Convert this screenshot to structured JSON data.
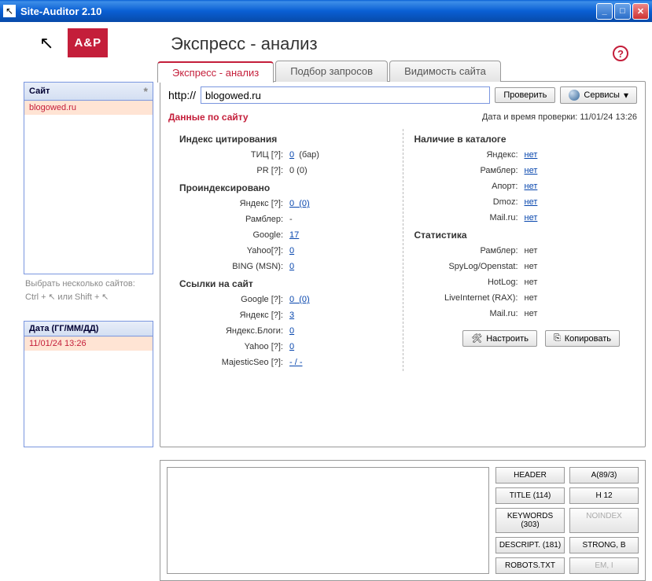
{
  "window": {
    "title": "Site-Auditor 2.10"
  },
  "header": {
    "logo": "A&P",
    "h1": "Экспресс - анализ"
  },
  "tabs": [
    "Экспресс - анализ",
    "Подбор запросов",
    "Видимость сайта"
  ],
  "activeTab": 0,
  "sidebar": {
    "sitesHeader": "Сайт",
    "sites": [
      "blogowed.ru"
    ],
    "hint1": "Выбрать несколько сайтов:",
    "hint2a": "Ctrl +",
    "hint2b": "или",
    "hint2c": "Shift +",
    "datesHeader": "Дата (ГГ/ММ/ДД)",
    "dates": [
      "11/01/24 13:26"
    ]
  },
  "url": {
    "proto": "http://",
    "value": "blogowed.ru",
    "check": "Проверить",
    "services": "Сервисы"
  },
  "dataHeader": "Данные по сайту",
  "checkedLabel": "Дата и время проверки:",
  "checkedValue": "11/01/24 13:26",
  "left": {
    "g1": "Индекс цитирования",
    "r1": {
      "l": "ТИЦ [?]:",
      "v": "0",
      "extra": "(бар)"
    },
    "r2": {
      "l": "PR [?]:",
      "v": "0 (0)"
    },
    "g2": "Проиндексировано",
    "r3": {
      "l": "Яндекс [?]:",
      "v": "0  (0)"
    },
    "r4": {
      "l": "Рамблер:",
      "v": "-"
    },
    "r5": {
      "l": "Google:",
      "v": "17"
    },
    "r6": {
      "l": "Yahoo[?]:",
      "v": "0"
    },
    "r7": {
      "l": "BING (MSN):",
      "v": "0"
    },
    "g3": "Ссылки на сайт",
    "r8": {
      "l": "Google [?]:",
      "v": "0  (0)"
    },
    "r9": {
      "l": "Яндекс [?]:",
      "v": "3"
    },
    "r10": {
      "l": "Яндекс.Блоги:",
      "v": "0"
    },
    "r11": {
      "l": "Yahoo [?]:",
      "v": "0"
    },
    "r12": {
      "l": "MajesticSeo [?]:",
      "v": "- / -"
    }
  },
  "rightcol": {
    "g1": "Наличие в каталоге",
    "r1": {
      "l": "Яндекс:",
      "v": "нет"
    },
    "r2": {
      "l": "Рамблер:",
      "v": "нет"
    },
    "r3": {
      "l": "Апорт:",
      "v": "нет"
    },
    "r4": {
      "l": "Dmoz:",
      "v": "нет"
    },
    "r5": {
      "l": "Mail.ru:",
      "v": "нет"
    },
    "g2": "Статистика",
    "r6": {
      "l": "Рамблер:",
      "v": "нет"
    },
    "r7": {
      "l": "SpyLog/Openstat:",
      "v": "нет"
    },
    "r8": {
      "l": "HotLog:",
      "v": "нет"
    },
    "r9": {
      "l": "LiveInternet (RAX):",
      "v": "нет"
    },
    "r10": {
      "l": "Mail.ru:",
      "v": "нет"
    }
  },
  "actions": {
    "configure": "Настроить",
    "copy": "Копировать"
  },
  "tags": {
    "header": "HEADER",
    "a": "A(89/3)",
    "title": "TITLE (114)",
    "h": "H 12",
    "keywords": "KEYWORDS (303)",
    "noindex": "NOINDEX",
    "descript": "DESCRIPT. (181)",
    "strong": "STRONG, B",
    "robots": "ROBOTS.TXT",
    "em": "EM, I"
  }
}
